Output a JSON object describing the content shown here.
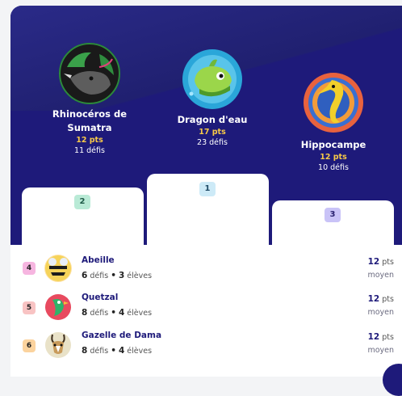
{
  "podium": {
    "first": {
      "name": "Dragon d'eau",
      "points": "17 pts",
      "defis": "23 défis",
      "rank": "1",
      "avatar_icon": "water-dragon-icon"
    },
    "second": {
      "name_line1": "Rhinocéros de",
      "name_line2": "Sumatra",
      "points": "12 pts",
      "defis": "11 défis",
      "rank": "2",
      "avatar_icon": "rhino-icon"
    },
    "third": {
      "name": "Hippocampe",
      "points": "12 pts",
      "defis": "10 défis",
      "rank": "3",
      "avatar_icon": "seahorse-icon"
    }
  },
  "list": [
    {
      "rank": "4",
      "name": "Abeille",
      "defis_count": "6",
      "defis_label": "défis",
      "bullet": "•",
      "eleves_count": "3",
      "eleves_label": "élèves",
      "points": "12",
      "points_unit": "pts",
      "avg_label": "moyen",
      "avatar_icon": "bee-icon",
      "rank_color": "#f6b5e0"
    },
    {
      "rank": "5",
      "name": "Quetzal",
      "defis_count": "8",
      "defis_label": "défis",
      "bullet": "•",
      "eleves_count": "4",
      "eleves_label": "élèves",
      "points": "12",
      "points_unit": "pts",
      "avg_label": "moyen",
      "avatar_icon": "quetzal-icon",
      "rank_color": "#f8c3c3"
    },
    {
      "rank": "6",
      "name": "Gazelle de Dama",
      "defis_count": "8",
      "defis_label": "défis",
      "bullet": "•",
      "eleves_count": "4",
      "eleves_label": "élèves",
      "points": "12",
      "points_unit": "pts",
      "avg_label": "moyen",
      "avatar_icon": "gazelle-icon",
      "rank_color": "#fbd39e"
    }
  ],
  "colors": {
    "podium_bg": "#1e1a7a",
    "points_yellow": "#f7c948",
    "badge1": "#cdeaf7",
    "badge2": "#b9ead6",
    "badge3": "#c9c3f7"
  }
}
